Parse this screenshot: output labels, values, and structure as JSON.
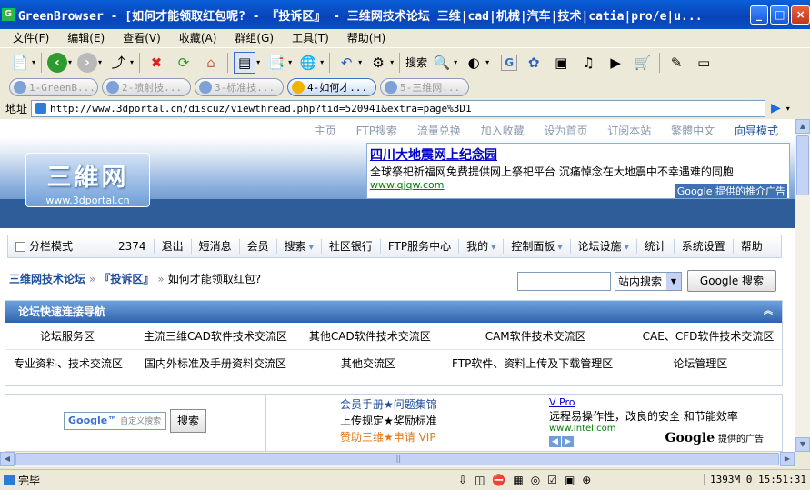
{
  "window": {
    "title": "GreenBrowser - [如何才能领取红包呢? - 『投诉区』 - 三维网技术论坛 三维|cad|机械|汽车|技术|catia|pro/e|u...",
    "controls": {
      "minimize": "_",
      "maximize": "□",
      "close": "×"
    }
  },
  "menubar": [
    "文件(F)",
    "编辑(E)",
    "查看(V)",
    "收藏(A)",
    "群组(G)",
    "工具(T)",
    "帮助(H)"
  ],
  "toolbar": {
    "search_label": "搜索"
  },
  "tabs": [
    {
      "label": "1-GreenB..."
    },
    {
      "label": "2-喷射技..."
    },
    {
      "label": "3-标准技..."
    },
    {
      "label": "4-如何才..."
    },
    {
      "label": "5-三维网..."
    }
  ],
  "address": {
    "label": "地址",
    "url": "http://www.3dportal.cn/discuz/viewthread.php?tid=520941&extra=page%3D1"
  },
  "page": {
    "topnav": [
      "主页",
      "FTP搜索",
      "流量兑换",
      "加入收藏",
      "设为首页",
      "订阅本站",
      "繁體中文",
      "向导模式"
    ],
    "logo": {
      "cn": "三維网",
      "url": "www.3dportal.cn"
    },
    "ad": {
      "headline": "四川大地震网上纪念园",
      "desc": "全球祭祀祈福网免费提供网上祭祀平台 沉痛悼念在大地震中不幸遇难的同胞",
      "url": "www.qjqw.com",
      "by": "Google 提供的推介广告"
    },
    "mainnav": {
      "split_mode": "分栏模式",
      "items": [
        "2374",
        "退出",
        "短消息",
        "会员",
        "搜索",
        "社区银行",
        "FTP服务中心",
        "我的",
        "控制面板",
        "论坛设施",
        "统计",
        "系统设置",
        "帮助"
      ]
    },
    "breadcrumb": {
      "forum": "三维网技术论坛",
      "section": "『投诉区』",
      "thread": "如何才能领取红包?"
    },
    "search": {
      "select": "站内搜索",
      "button": "Google 搜索"
    },
    "quicknav": {
      "header": "论坛快速连接导航",
      "row1": [
        "论坛服务区",
        "主流三维CAD软件技术交流区",
        "其他CAD软件技术交流区",
        "CAM软件技术交流区",
        "CAE、CFD软件技术交流区"
      ],
      "row2": [
        "专业资料、技术交流区",
        "国内外标准及手册资料交流区",
        "其他交流区",
        "FTP软件、资料上传及下载管理区",
        "论坛管理区"
      ]
    },
    "bottom": {
      "gsearch_placeholder": "自定义搜索",
      "gsearch_button": "搜索",
      "links": [
        "会员手册★问题集锦",
        "上传规定★奖励标准",
        "赞助三维★申请 VIP"
      ],
      "ad2": {
        "title": "V Pro",
        "desc": "远程易操作性，改良的安全 和节能效率",
        "url": "www.Intel.com"
      },
      "google_brand": "Google",
      "google_tag": "提供的广告"
    }
  },
  "status": {
    "text": "完毕",
    "time": "1393M_0_15:51:31"
  }
}
